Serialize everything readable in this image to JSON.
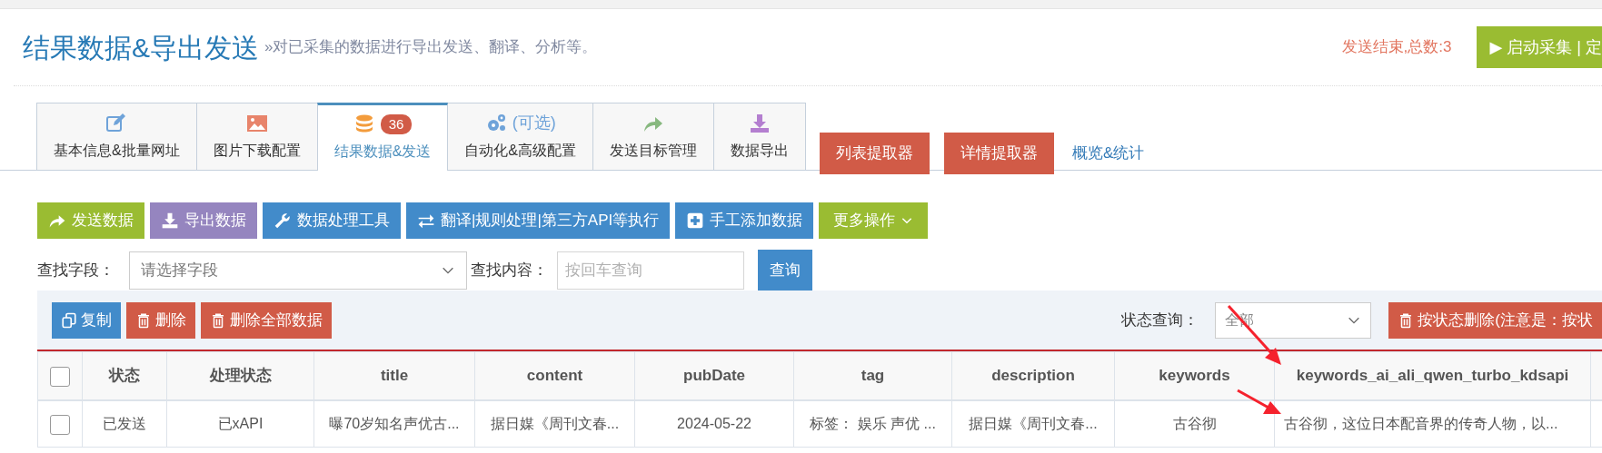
{
  "header": {
    "title": "结果数据&导出发送",
    "subtitle": "»对已采集的数据进行导出发送、翻译、分析等。",
    "status": "发送结束,总数:3",
    "start_button": "▶ 启动采集 | 定"
  },
  "tabs": [
    {
      "label": "基本信息&批量网址",
      "kind": "edit",
      "selected": false
    },
    {
      "label": "图片下载配置",
      "kind": "image",
      "selected": false
    },
    {
      "label": "结果数据&发送",
      "kind": "database",
      "badge": "36",
      "selected": true
    },
    {
      "label": "自动化&高级配置",
      "kind": "gears",
      "extra": "(可选)",
      "selected": false
    },
    {
      "label": "发送目标管理",
      "kind": "share",
      "selected": false
    },
    {
      "label": "数据导出",
      "kind": "download",
      "selected": false
    }
  ],
  "tab_actions": [
    {
      "kind": "button",
      "label": "列表提取器"
    },
    {
      "kind": "button",
      "label": "详情提取器"
    },
    {
      "kind": "link",
      "label": "概览&统计"
    }
  ],
  "toolbar": [
    {
      "label": "发送数据",
      "kind": "share",
      "color": "#9abc32"
    },
    {
      "label": "导出数据",
      "kind": "download",
      "color": "#9585bf"
    },
    {
      "label": "数据处理工具",
      "kind": "wrench",
      "color": "#428bca"
    },
    {
      "label": "翻译|规则处理|第三方API等执行",
      "kind": "exchange",
      "color": "#428bca"
    },
    {
      "label": "手工添加数据",
      "kind": "plus",
      "color": "#428bca"
    },
    {
      "label": "更多操作",
      "kind": "dropdown",
      "color": "#9abc32"
    }
  ],
  "search": {
    "field_label": "查找字段：",
    "field_placeholder": "请选择字段",
    "content_label": "查找内容：",
    "content_placeholder": "按回车查询",
    "button": "查询"
  },
  "table_actions": [
    {
      "label": "复制",
      "kind": "copy",
      "color": "#428bca"
    },
    {
      "label": "删除",
      "kind": "trash",
      "color": "#d15b47"
    },
    {
      "label": "删除全部数据",
      "kind": "trash",
      "color": "#d15b47"
    }
  ],
  "status_filter": {
    "label": "状态查询：",
    "value": "全部",
    "button": "按状态删除(注意是：按状"
  },
  "table": {
    "header_checked": false,
    "columns": [
      "状态",
      "处理状态",
      "title",
      "content",
      "pubDate",
      "tag",
      "description",
      "keywords",
      "keywords_ai_ali_qwen_turbo_kdsapi"
    ],
    "rows": [
      {
        "checked": false,
        "cells": [
          "已发送",
          "已xAPI",
          "曝70岁知名声优古...",
          "据日媒《周刊文春...",
          "2024-05-22",
          "标签： 娱乐 声优 ...",
          "据日媒《周刊文春...",
          "古谷彻",
          "古谷彻，这位日本配音界的传奇人物，以..."
        ]
      }
    ]
  }
}
